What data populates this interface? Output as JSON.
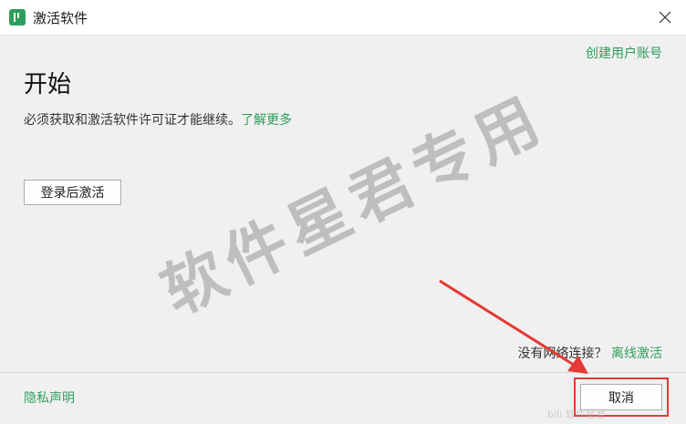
{
  "window": {
    "title": "激活软件",
    "close_icon": "close-icon"
  },
  "header": {
    "create_account_link": "创建用户账号"
  },
  "main": {
    "heading": "开始",
    "description": "必须获取和激活软件许可证才能继续。",
    "learn_more_link": "了解更多",
    "login_button": "登录后激活"
  },
  "footer": {
    "no_network_text": "没有网络连接？",
    "offline_link": "离线激活",
    "privacy_link": "隐私声明",
    "cancel_button": "取消"
  },
  "watermark": {
    "text": "软件星君专用"
  },
  "corner_watermark": "bili 软件星君",
  "colors": {
    "accent": "#2e9e5b",
    "annotation": "#e53935"
  }
}
